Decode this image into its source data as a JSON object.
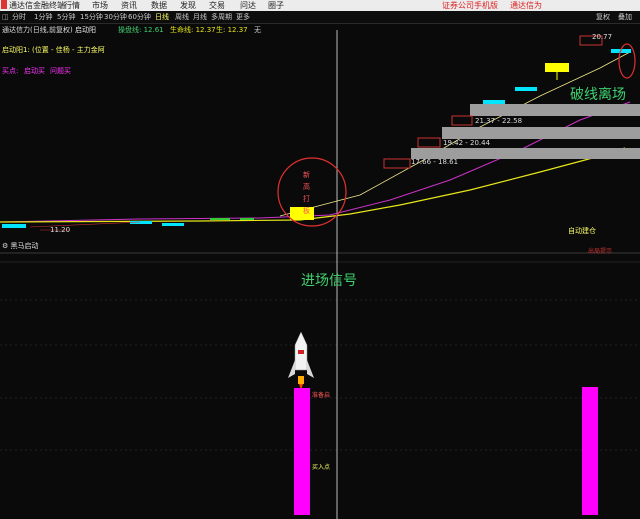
{
  "menu": {
    "title": "通达信金融终端",
    "items": [
      "行情",
      "市场",
      "资讯",
      "数据",
      "发现",
      "交易",
      "问达",
      "圈子"
    ],
    "right_links": [
      "证券公司手机版",
      "通达信为"
    ]
  },
  "toolbar": {
    "periods": [
      "分时",
      "1分钟",
      "5分钟",
      "15分钟",
      "30分钟",
      "60分钟",
      "日线",
      "周线",
      "月线",
      "多周期",
      "更多"
    ],
    "active_period": "日线",
    "right_buttons": [
      "复权",
      "叠加"
    ]
  },
  "upper_panel": {
    "indicator_line": "通达信力(日线,前复权)",
    "indicator_extra": "启动阳",
    "ma_values": [
      "操盘线: 12.61",
      "生命线: 12.37",
      "生: 12.37",
      "无"
    ],
    "line2": "启动阳1: (位置 - 佳杨 - 主力金阿",
    "line3_labels": [
      "买点: ",
      "启动买",
      "问题买"
    ],
    "annotation_break": "破线离场",
    "price_labels": [
      "20.77",
      "21.37 - 22.58",
      "19.42 - 20.44",
      "17.66 - 18.61",
      "11.20"
    ],
    "circle_text": [
      "新",
      "高",
      "打",
      "板"
    ],
    "small_signal": "自动建仓",
    "right_small": "出局提示"
  },
  "lower_panel": {
    "title": "黑马启动",
    "entry_annotation": "进场信号",
    "bar_labels": [
      "准备启",
      "买入点"
    ]
  },
  "colors": {
    "background": "#0a0a0a",
    "magenta": "#ff00ff",
    "yellow": "#ffff00",
    "cyan": "#00e5ff",
    "green_text": "#3fd16f",
    "red": "#ff3333",
    "gray_box": "#a0a0a0"
  },
  "icons": [
    "rocket-icon",
    "logo-icon",
    "settings-icon"
  ]
}
